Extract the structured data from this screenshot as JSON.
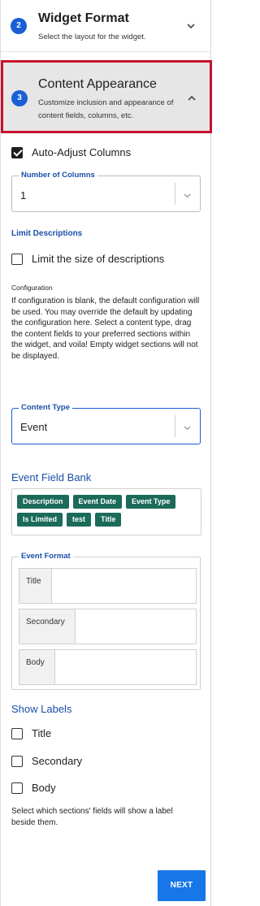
{
  "steps": [
    {
      "number": "2",
      "title": "Widget Format",
      "subtitle": "Select the layout for the widget."
    },
    {
      "number": "3",
      "title": "Content Appearance",
      "subtitle": "Customize inclusion and appearance of content fields, columns, etc."
    }
  ],
  "auto_adjust": {
    "label": "Auto-Adjust Columns",
    "checked": true
  },
  "num_columns": {
    "legend": "Number of Columns",
    "value": "1"
  },
  "limit_descriptions": {
    "heading": "Limit Descriptions",
    "checkbox_label": "Limit the size of descriptions",
    "checked": false
  },
  "configuration": {
    "label": "Configuration",
    "text": "If configuration is blank, the default configuration will be used. You may override the default by updating the configuration here. Select a content type, drag the content fields to your preferred sections within the widget, and voila! Empty widget sections will not be displayed."
  },
  "content_type": {
    "legend": "Content Type",
    "value": "Event"
  },
  "field_bank": {
    "title": "Event Field Bank",
    "chips": [
      "Description",
      "Event Date",
      "Event Type",
      "Is Limited",
      "test",
      "Title"
    ]
  },
  "event_format": {
    "legend": "Event Format",
    "rows": [
      "Title",
      "Secondary",
      "Body"
    ]
  },
  "show_labels": {
    "title": "Show Labels",
    "options": [
      {
        "label": "Title",
        "checked": false
      },
      {
        "label": "Secondary",
        "checked": false
      },
      {
        "label": "Body",
        "checked": false
      }
    ],
    "help": "Select which sections' fields will show a label beside them."
  },
  "next_button": "NEXT",
  "colors": {
    "accent": "#1a5fd6",
    "chip": "#1c6b5a",
    "highlight_border": "#c8102e",
    "next": "#1776e8"
  }
}
